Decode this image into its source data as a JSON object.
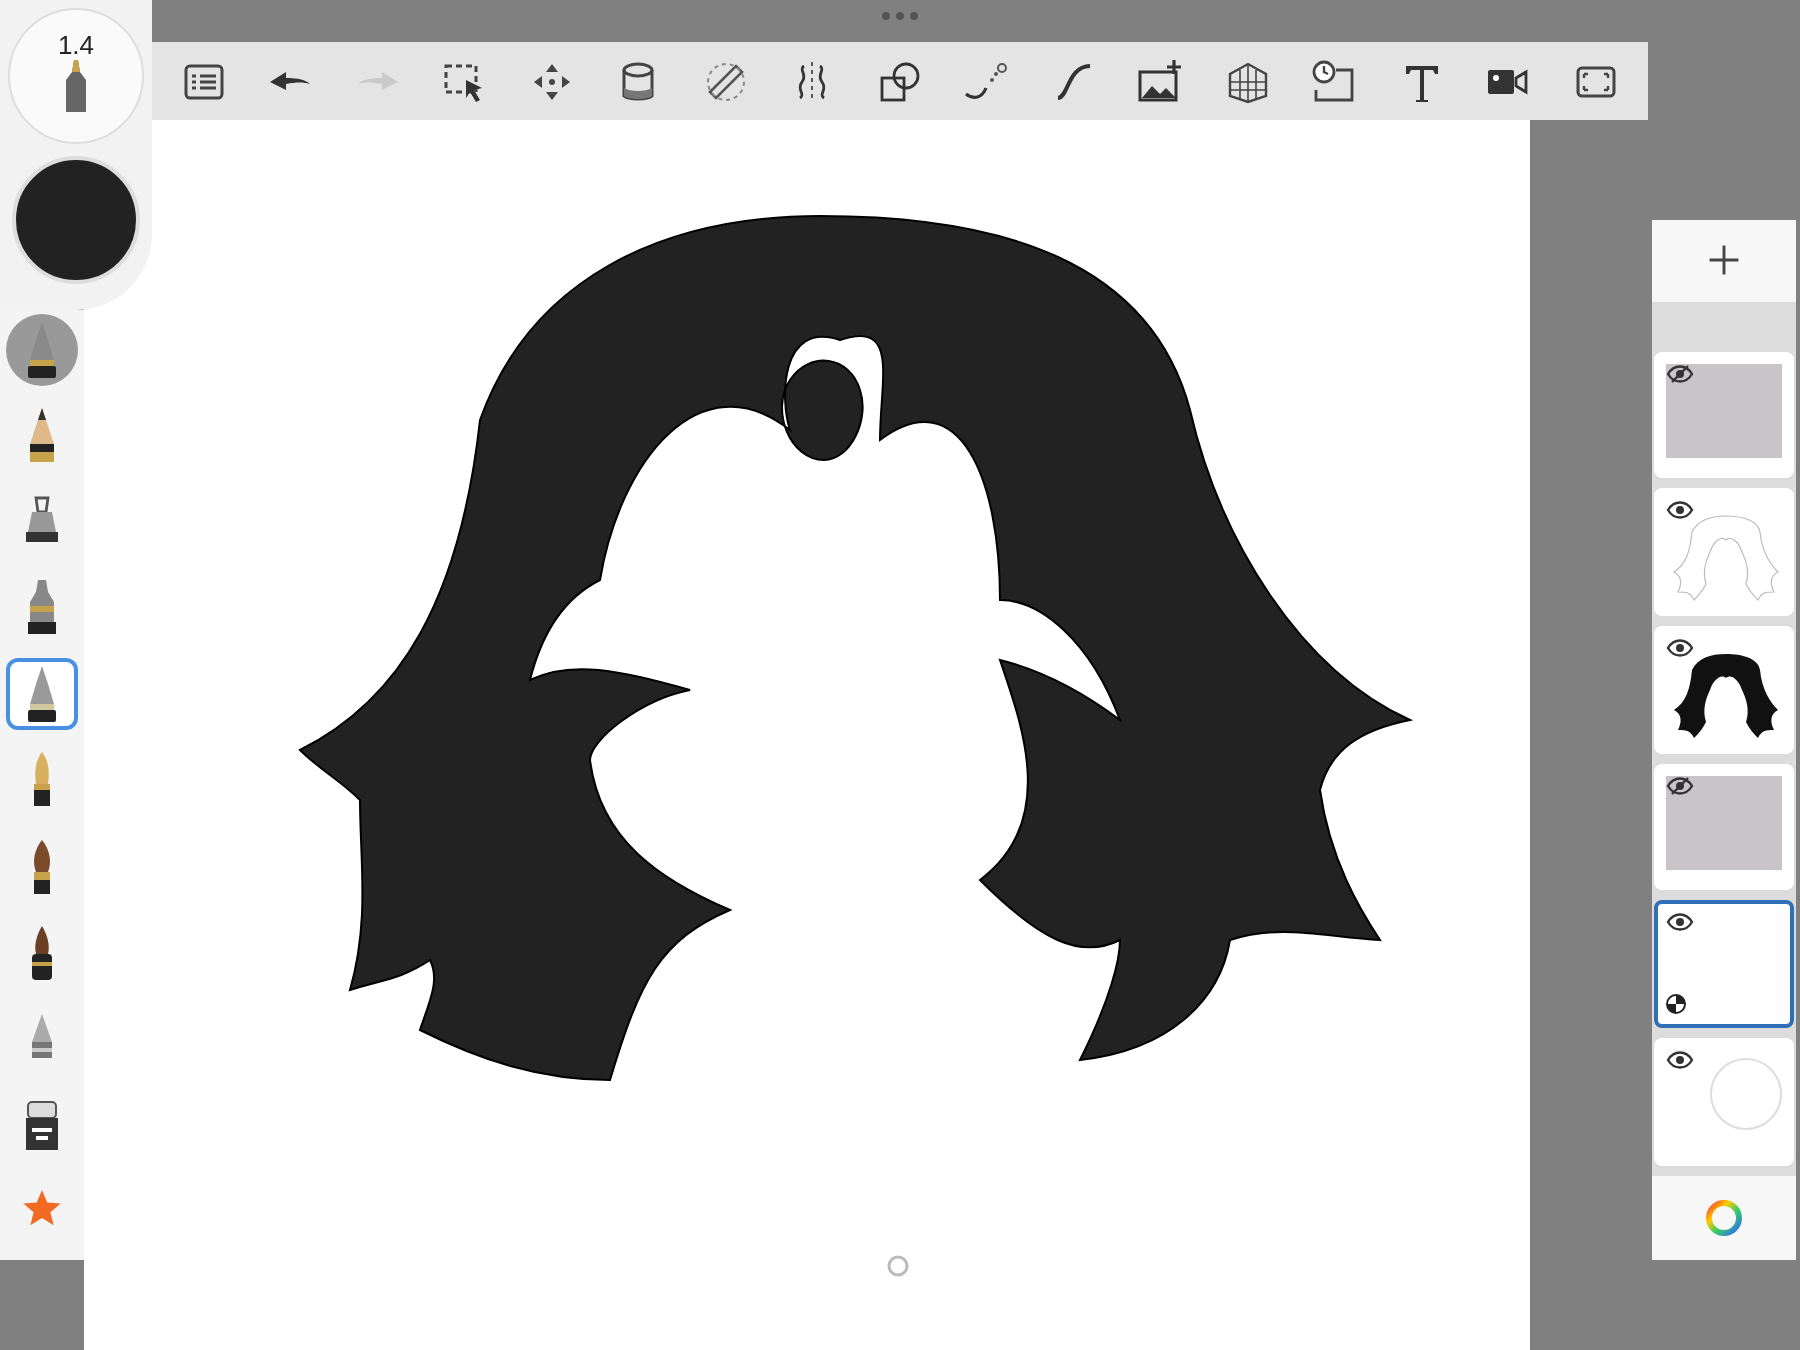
{
  "brush": {
    "size": "1.4",
    "color": "#222222"
  },
  "toolbar": [
    {
      "kind": "layers",
      "disabled": false
    },
    {
      "kind": "undo",
      "disabled": false
    },
    {
      "kind": "redo",
      "disabled": true
    },
    {
      "kind": "select",
      "disabled": false
    },
    {
      "kind": "transform",
      "disabled": false
    },
    {
      "kind": "fill",
      "disabled": false
    },
    {
      "kind": "ruler",
      "disabled": false
    },
    {
      "kind": "symmetry",
      "disabled": false
    },
    {
      "kind": "shapes",
      "disabled": false
    },
    {
      "kind": "predictive",
      "disabled": false
    },
    {
      "kind": "steady",
      "disabled": false
    },
    {
      "kind": "image",
      "disabled": false
    },
    {
      "kind": "perspective",
      "disabled": false
    },
    {
      "kind": "timelapse",
      "disabled": false
    },
    {
      "kind": "text",
      "disabled": false
    },
    {
      "kind": "record",
      "disabled": false
    },
    {
      "kind": "fullscreen",
      "disabled": false
    }
  ],
  "tools": [
    {
      "kind": "recent",
      "selected": false
    },
    {
      "kind": "pencil",
      "selected": false
    },
    {
      "kind": "marker",
      "selected": false
    },
    {
      "kind": "inkpen",
      "selected": false
    },
    {
      "kind": "ballpoint",
      "selected": true
    },
    {
      "kind": "fountain",
      "selected": false
    },
    {
      "kind": "brush",
      "selected": false
    },
    {
      "kind": "brushdark",
      "selected": false
    },
    {
      "kind": "airbrush",
      "selected": false
    },
    {
      "kind": "eraser",
      "selected": false
    },
    {
      "kind": "favorites",
      "selected": false
    }
  ],
  "layers": [
    {
      "kind": "picture",
      "visible": false,
      "selected": false
    },
    {
      "kind": "sketch",
      "visible": true,
      "selected": false
    },
    {
      "kind": "fill",
      "visible": true,
      "selected": false
    },
    {
      "kind": "picture",
      "visible": false,
      "selected": false
    },
    {
      "kind": "empty",
      "visible": true,
      "selected": true
    },
    {
      "kind": "background",
      "visible": true,
      "selected": false
    }
  ]
}
